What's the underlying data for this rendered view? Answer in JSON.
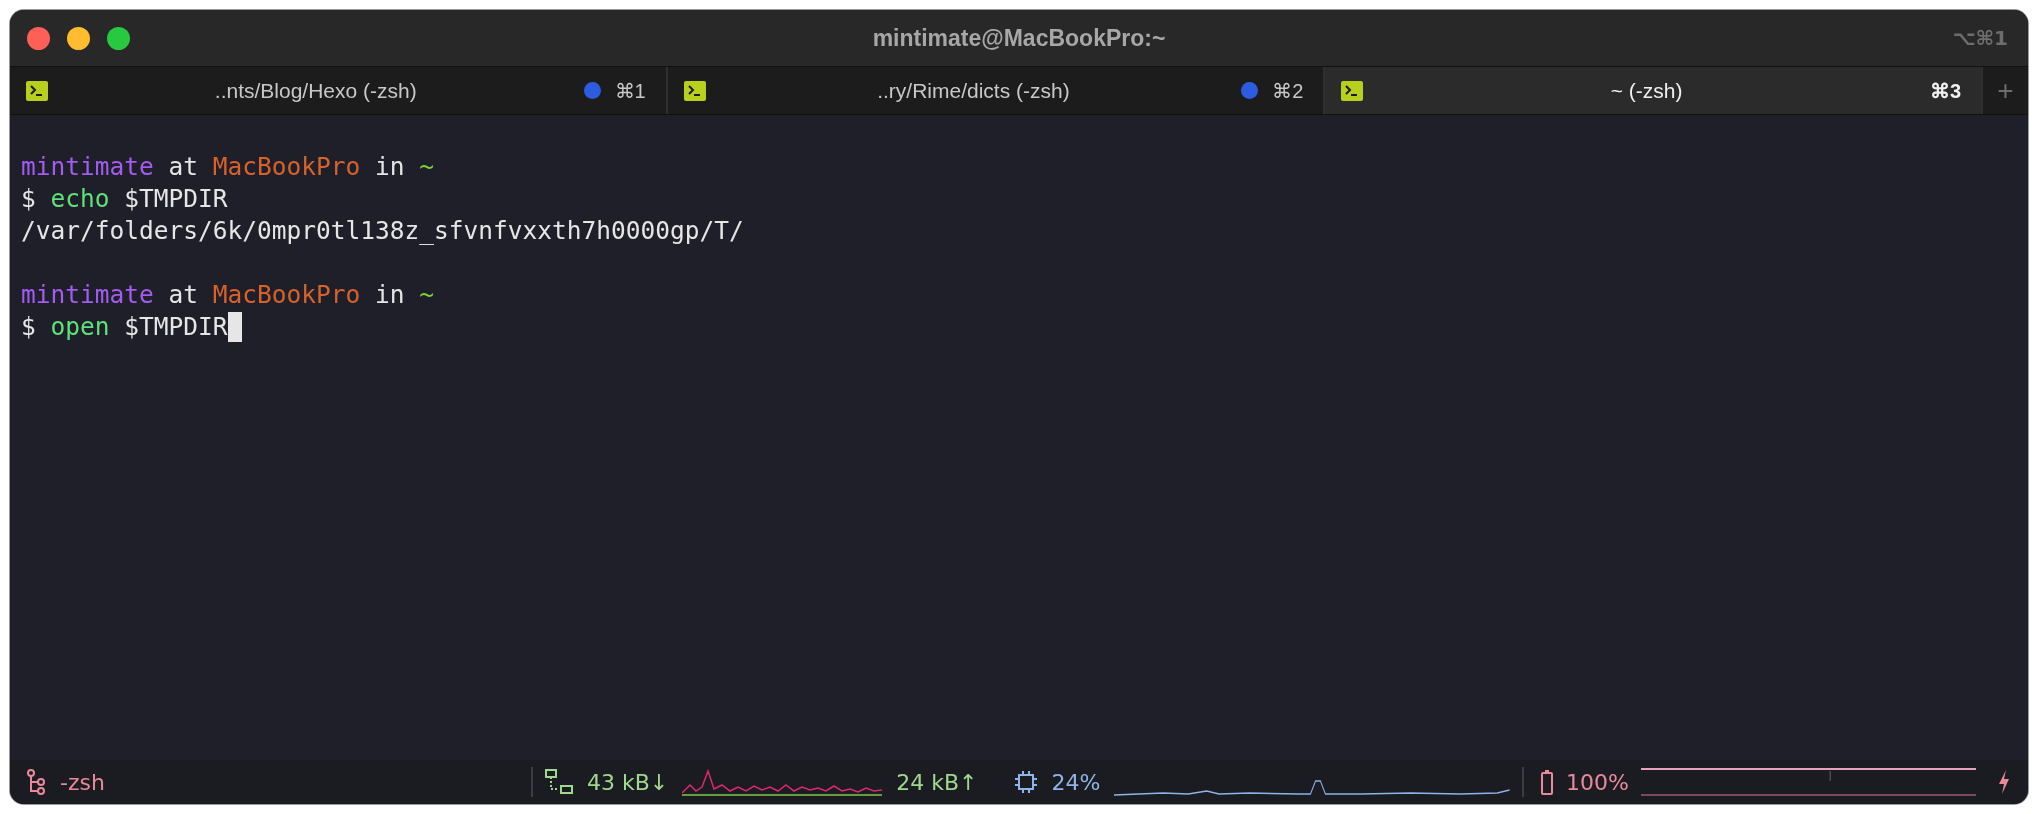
{
  "window": {
    "title": "mintimate@MacBookPro:~",
    "shortcut": "⌥⌘1"
  },
  "tabs": [
    {
      "title": "..nts/Blog/Hexo (-zsh)",
      "activity": true,
      "shortcut": "⌘1",
      "selected": false
    },
    {
      "title": "..ry/Rime/dicts (-zsh)",
      "activity": true,
      "shortcut": "⌘2",
      "selected": false
    },
    {
      "title": "~ (-zsh)",
      "activity": false,
      "shortcut": "⌘3",
      "selected": true
    }
  ],
  "new_tab": "+",
  "terminal": {
    "blocks": [
      {
        "lines": [
          {
            "segments": [
              {
                "kind": "user",
                "text": "mintimate"
              },
              {
                "kind": "plain",
                "text": " at "
              },
              {
                "kind": "host",
                "text": "MacBookPro"
              },
              {
                "kind": "plain",
                "text": " in "
              },
              {
                "kind": "path",
                "text": "~"
              }
            ]
          },
          {
            "segments": [
              {
                "kind": "plain",
                "text": "$ "
              },
              {
                "kind": "command",
                "text": "echo"
              },
              {
                "kind": "plain",
                "text": " $TMPDIR"
              }
            ]
          },
          {
            "segments": [
              {
                "kind": "plain",
                "text": "/var/folders/6k/0mpr0tl138z_sfvnfvxxth7h0000gp/T/"
              }
            ]
          }
        ]
      },
      {
        "lines": [
          {
            "segments": [
              {
                "kind": "user",
                "text": "mintimate"
              },
              {
                "kind": "plain",
                "text": " at "
              },
              {
                "kind": "host",
                "text": "MacBookPro"
              },
              {
                "kind": "plain",
                "text": " in "
              },
              {
                "kind": "path",
                "text": "~"
              }
            ]
          },
          {
            "segments": [
              {
                "kind": "plain",
                "text": "$ "
              },
              {
                "kind": "command",
                "text": "open"
              },
              {
                "kind": "plain",
                "text": " $TMPDIR"
              }
            ],
            "cursor": true
          }
        ]
      }
    ]
  },
  "status_bar": {
    "session": "-zsh",
    "download": "43 kB↓",
    "upload": "24 kB↑",
    "cpu": "24%",
    "battery": "100%",
    "charging": true
  }
}
